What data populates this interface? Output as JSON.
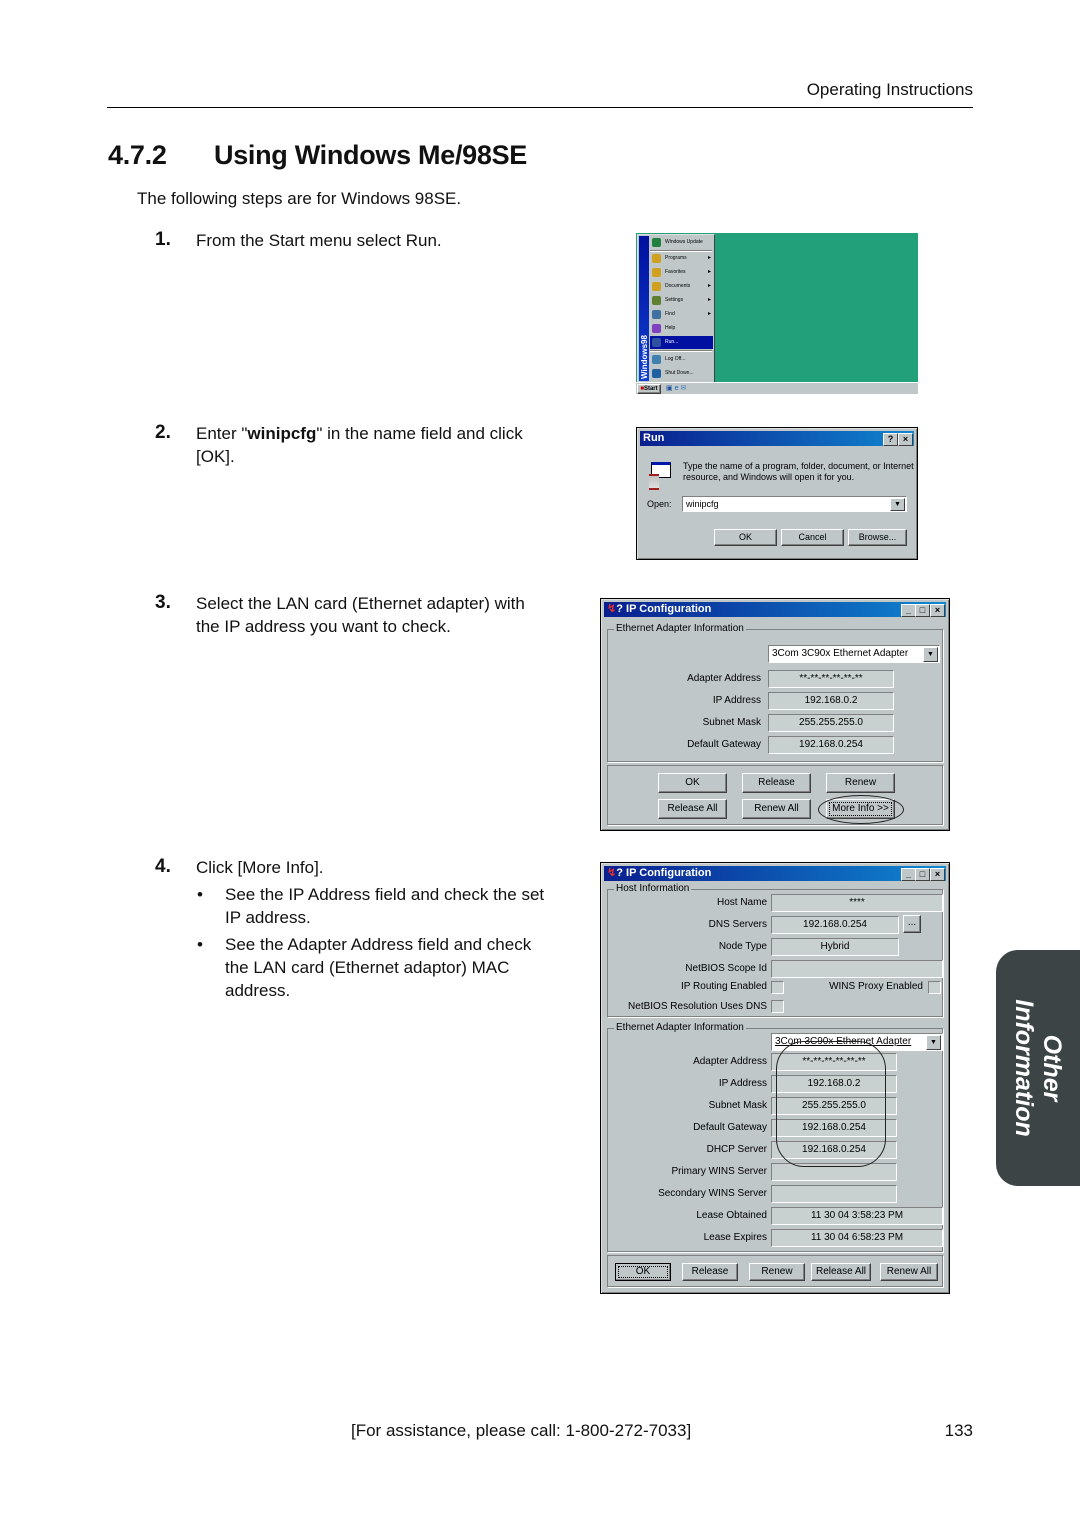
{
  "header": {
    "running_head": "Operating Instructions",
    "section_number": "4.7.2",
    "section_title": "Using Windows Me/98SE",
    "intro": "The following steps are for Windows 98SE."
  },
  "steps": [
    {
      "number": "1.",
      "text": "From the Start menu select Run."
    },
    {
      "number": "2.",
      "text_before": "Enter \"",
      "text_bold": "winipcfg",
      "text_after": "\" in the name field and click",
      "text_line2": "[OK]."
    },
    {
      "number": "3.",
      "line1": "Select the LAN card (Ethernet adapter) with",
      "line2": "the IP address you want to check."
    },
    {
      "number": "4.",
      "text": "Click [More Info].",
      "bullets": [
        {
          "symbol": "•",
          "line1": "See the IP Address field and check the set",
          "line2": "IP address."
        },
        {
          "symbol": "•",
          "line1": "See the Adapter Address field and check",
          "line2": "the LAN card (Ethernet adaptor) MAC",
          "line3": "address."
        }
      ]
    }
  ],
  "start_menu": {
    "desktop_color": "#22a07a",
    "banner": "Windows98",
    "items": [
      {
        "label": "Windows Update",
        "icon": "globe-icon",
        "submenu": false
      },
      {
        "label": "Programs",
        "icon": "programs-folder-icon",
        "submenu": true
      },
      {
        "label": "Favorites",
        "icon": "favorites-folder-icon",
        "submenu": true
      },
      {
        "label": "Documents",
        "icon": "documents-folder-icon",
        "submenu": true
      },
      {
        "label": "Settings",
        "icon": "settings-icon",
        "submenu": true
      },
      {
        "label": "Find",
        "icon": "find-icon",
        "submenu": true
      },
      {
        "label": "Help",
        "icon": "help-book-icon",
        "submenu": false
      },
      {
        "label": "Run...",
        "icon": "run-icon",
        "submenu": false,
        "selected": true
      },
      {
        "label": "Log Off...",
        "icon": "log-off-icon",
        "submenu": false
      },
      {
        "label": "Shut Down...",
        "icon": "shut-down-icon",
        "submenu": false
      }
    ],
    "start_button": "Start"
  },
  "run_dialog": {
    "title": "Run",
    "help_btn": "?",
    "close_btn": "×",
    "description_line1": "Type the name of a program, folder, document, or Internet",
    "description_line2": "resource, and Windows will open it for you.",
    "open_label": "Open:",
    "open_value": "winipcfg",
    "ok": "OK",
    "cancel": "Cancel",
    "browse": "Browse..."
  },
  "ipconfig_basic": {
    "title": "IP Configuration",
    "group_title": "Ethernet  Adapter Information",
    "adapter": "3Com 3C90x Ethernet Adapter",
    "fields": [
      {
        "label": "Adapter Address",
        "value": "**-**-**-**-**-**"
      },
      {
        "label": "IP Address",
        "value": "192.168.0.2"
      },
      {
        "label": "Subnet Mask",
        "value": "255.255.255.0"
      },
      {
        "label": "Default Gateway",
        "value": "192.168.0.254"
      }
    ],
    "buttons": {
      "ok": "OK",
      "release": "Release",
      "renew": "Renew",
      "release_all": "Release All",
      "renew_all": "Renew All",
      "more_info": "More Info >>"
    }
  },
  "ipconfig_detailed": {
    "title": "IP Configuration",
    "host_group_title": "Host Information",
    "host_fields": {
      "host_name_label": "Host Name",
      "host_name": "****",
      "dns_label": "DNS Servers",
      "dns": "192.168.0.254",
      "dns_more": "...",
      "node_type_label": "Node Type",
      "node_type": "Hybrid",
      "scope_label": "NetBIOS Scope Id",
      "scope": "",
      "ip_routing_label": "IP Routing Enabled",
      "wins_proxy_label": "WINS Proxy Enabled",
      "netbios_dns_label": "NetBIOS Resolution Uses DNS"
    },
    "adapter_group_title": "Ethernet  Adapter Information",
    "adapter": "3Com 3C90x Ethernet Adapter",
    "fields": [
      {
        "label": "Adapter Address",
        "value": "**-**-**-**-**-**"
      },
      {
        "label": "IP Address",
        "value": "192.168.0.2"
      },
      {
        "label": "Subnet Mask",
        "value": "255.255.255.0"
      },
      {
        "label": "Default Gateway",
        "value": "192.168.0.254"
      },
      {
        "label": "DHCP Server",
        "value": "192.168.0.254"
      },
      {
        "label": "Primary WINS Server",
        "value": ""
      },
      {
        "label": "Secondary WINS Server",
        "value": ""
      }
    ],
    "lease_obtained_label": "Lease Obtained",
    "lease_obtained": "11 30 04 3:58:23 PM",
    "lease_expires_label": "Lease Expires",
    "lease_expires": "11 30 04 6:58:23 PM",
    "buttons": {
      "ok": "OK",
      "release": "Release",
      "renew": "Renew",
      "release_all": "Release All",
      "renew_all": "Renew All"
    }
  },
  "side_tab": {
    "line1": "Other",
    "line2": "Information"
  },
  "footer": {
    "assistance": "[For assistance, please call: 1-800-272-7033]",
    "page_number": "133"
  }
}
